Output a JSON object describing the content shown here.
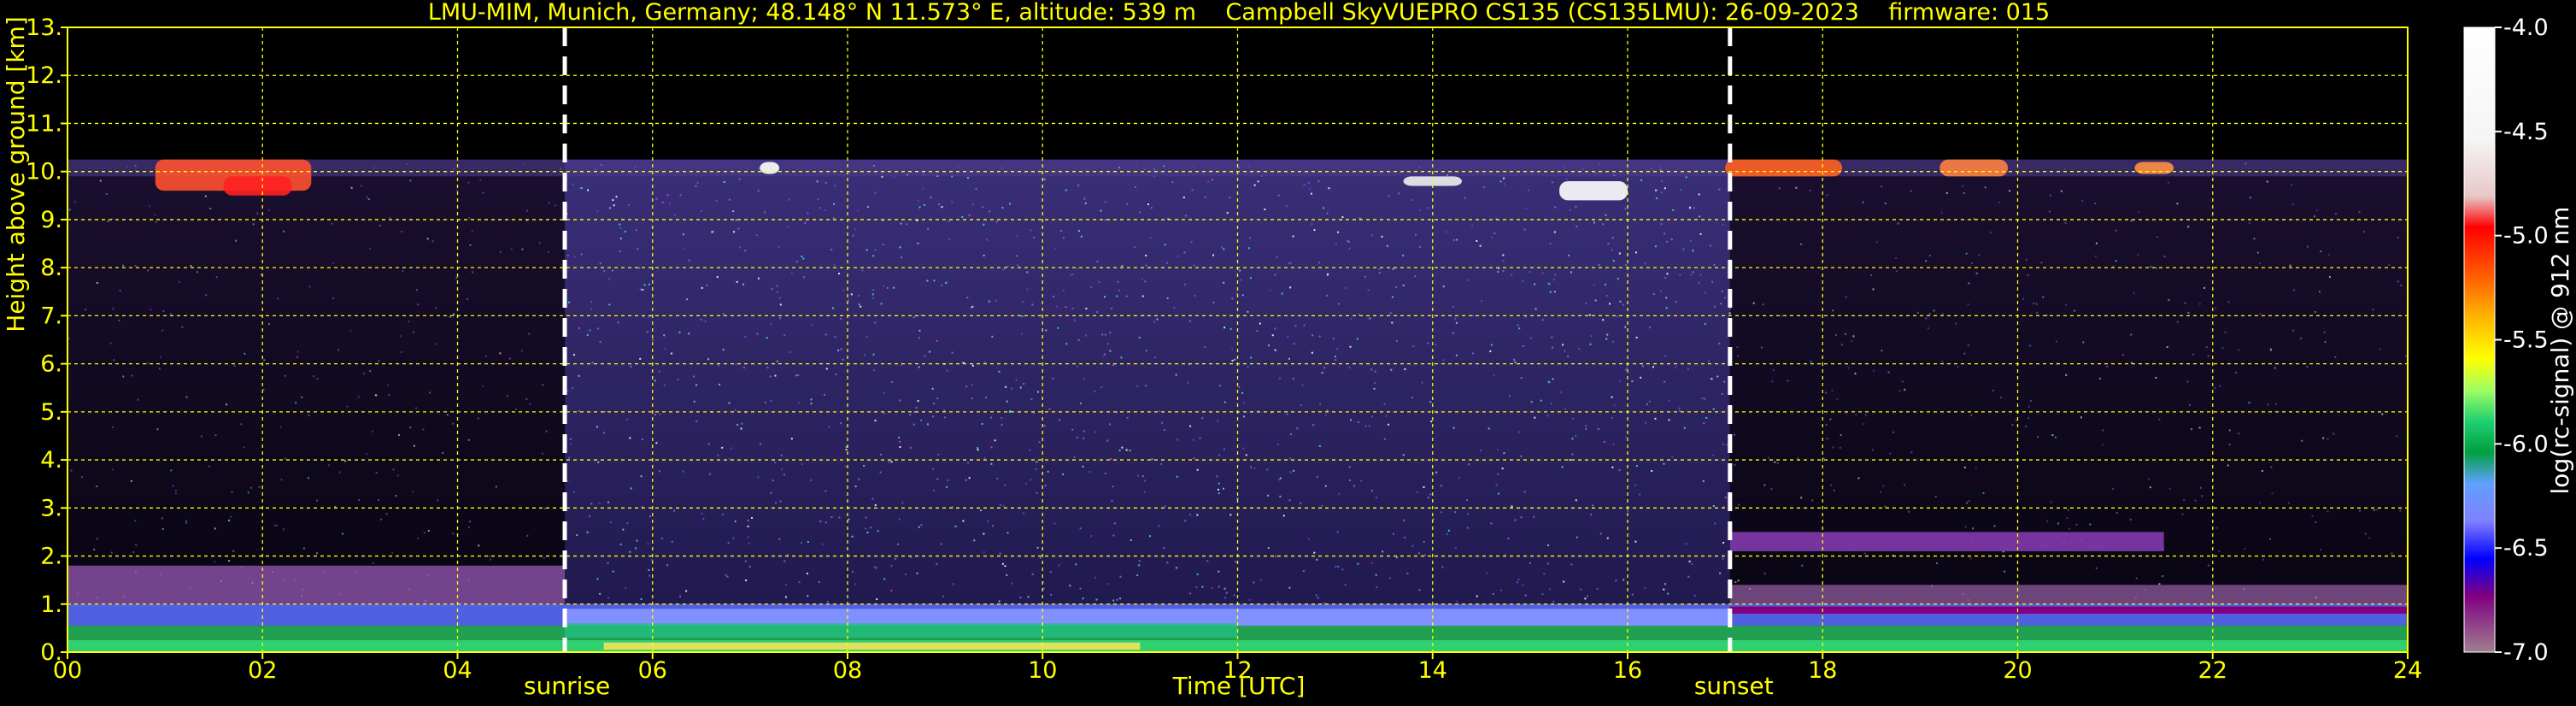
{
  "title": "LMU-MIM, Munich, Germany; 48.148° N 11.573° E, altitude: 539 m    Campbell SkyVUEPRO CS135 (CS135LMU): 26-09-2023    firmware: 015",
  "chart_data": {
    "type": "heatmap",
    "xlabel": "Time [UTC]",
    "ylabel": "Height above ground [km]",
    "xlim": [
      0,
      24
    ],
    "ylim": [
      0,
      13
    ],
    "x_ticks": [
      "00",
      "02",
      "04",
      "06",
      "08",
      "10",
      "12",
      "14",
      "16",
      "18",
      "20",
      "22",
      "24"
    ],
    "y_ticks": [
      "0.",
      "1.",
      "2.",
      "3.",
      "4.",
      "5.",
      "6.",
      "7.",
      "8.",
      "9.",
      "10.",
      "11.",
      "12.",
      "13."
    ],
    "grid": true,
    "annotations": [
      {
        "label": "sunrise",
        "x": 5.1
      },
      {
        "label": "sunset",
        "x": 17.05
      }
    ],
    "colorbar": {
      "label": "log(rc-signal) @ 912 nm",
      "range": [
        -7.0,
        -4.0
      ],
      "ticks": [
        "-4.0",
        "-4.5",
        "-5.0",
        "-5.5",
        "-6.0",
        "-6.5",
        "-7.0"
      ]
    }
  },
  "colors": {
    "axis_text": "#ffff00",
    "grid": "#ffff00",
    "background": "#000000",
    "marker_line": "#ffffff"
  }
}
